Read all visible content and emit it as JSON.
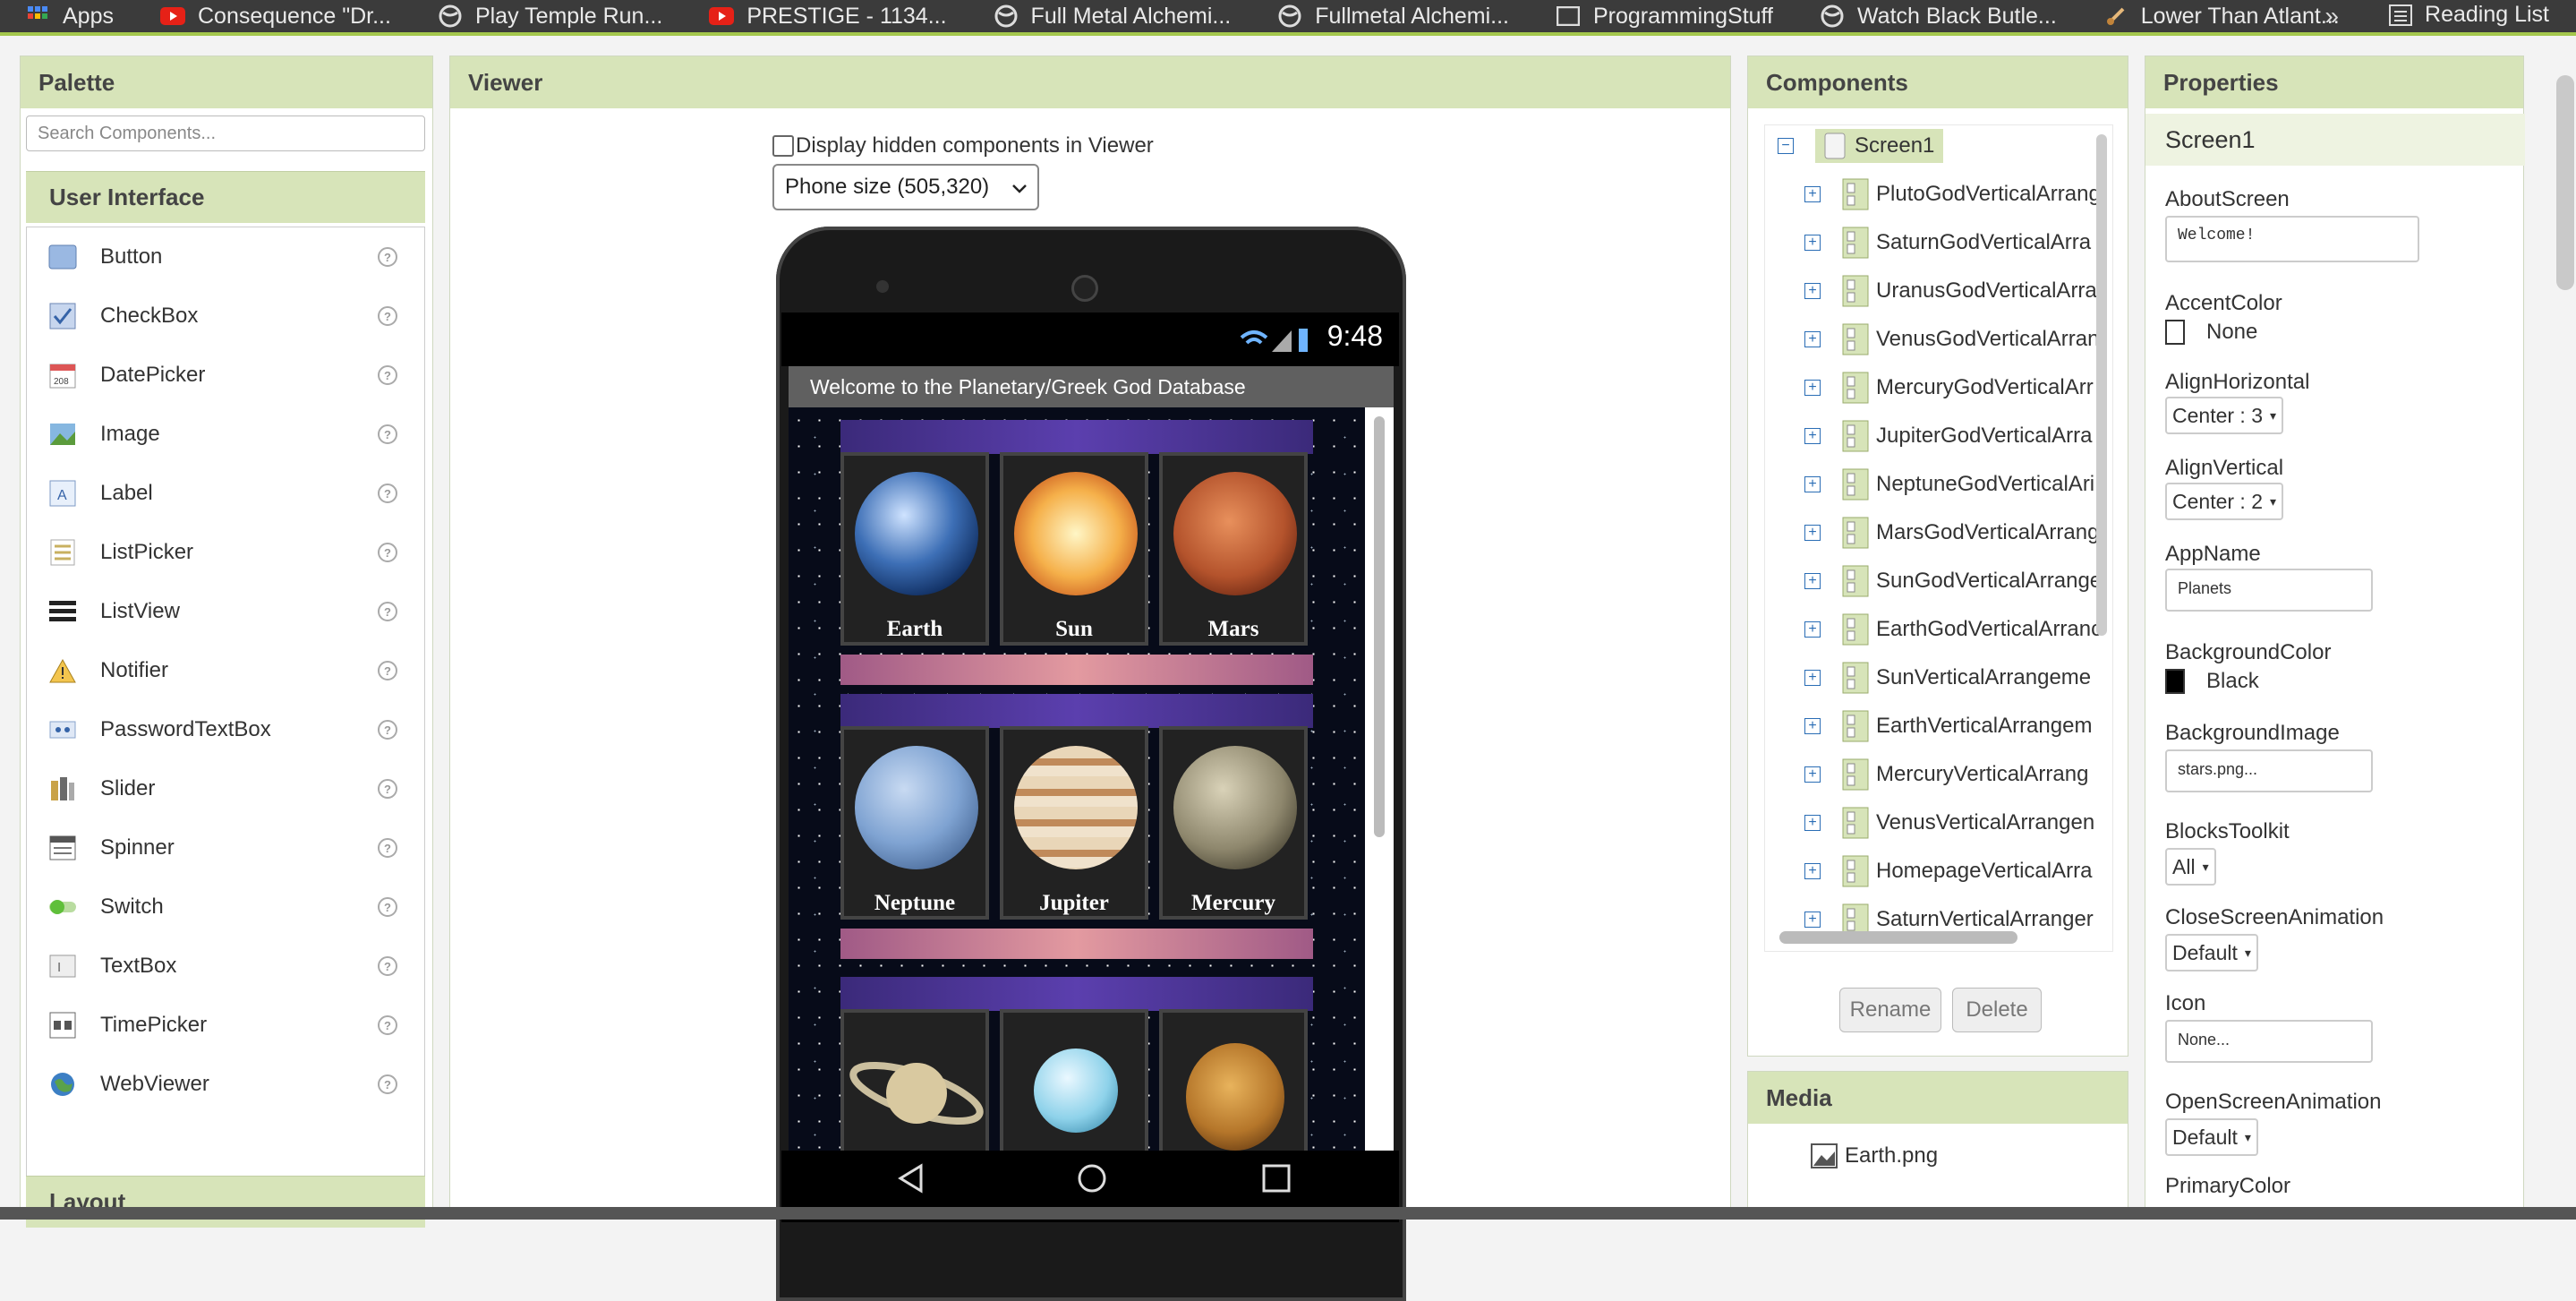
{
  "bookmarks": {
    "items": [
      {
        "label": "Apps",
        "icon": "apps-grid-icon"
      },
      {
        "label": "Consequence \"Dr...",
        "icon": "youtube-icon"
      },
      {
        "label": "Play Temple Run...",
        "icon": "globe-icon"
      },
      {
        "label": "PRESTIGE - 1134...",
        "icon": "youtube-icon"
      },
      {
        "label": "Full Metal Alchemi...",
        "icon": "globe-icon"
      },
      {
        "label": "Fullmetal Alchemi...",
        "icon": "globe-icon"
      },
      {
        "label": "ProgrammingStuff",
        "icon": "folder-icon"
      },
      {
        "label": "Watch Black Butle...",
        "icon": "globe-icon"
      },
      {
        "label": "Lower Than Atlant...",
        "icon": "guitar-icon"
      }
    ],
    "overflow": "»",
    "reading_list": "Reading List"
  },
  "palette": {
    "title": "Palette",
    "search_placeholder": "Search Components...",
    "category": "User Interface",
    "items": [
      {
        "label": "Button",
        "icon": "button-icon"
      },
      {
        "label": "CheckBox",
        "icon": "checkbox-icon"
      },
      {
        "label": "DatePicker",
        "icon": "datepicker-icon"
      },
      {
        "label": "Image",
        "icon": "image-icon"
      },
      {
        "label": "Label",
        "icon": "label-icon"
      },
      {
        "label": "ListPicker",
        "icon": "listpicker-icon"
      },
      {
        "label": "ListView",
        "icon": "listview-icon"
      },
      {
        "label": "Notifier",
        "icon": "notifier-icon"
      },
      {
        "label": "PasswordTextBox",
        "icon": "password-icon"
      },
      {
        "label": "Slider",
        "icon": "slider-icon"
      },
      {
        "label": "Spinner",
        "icon": "spinner-icon"
      },
      {
        "label": "Switch",
        "icon": "switch-icon"
      },
      {
        "label": "TextBox",
        "icon": "textbox-icon"
      },
      {
        "label": "TimePicker",
        "icon": "timepicker-icon"
      },
      {
        "label": "WebViewer",
        "icon": "webviewer-icon"
      }
    ],
    "help": "?",
    "layout_category": "Layout"
  },
  "viewer": {
    "title": "Viewer",
    "hidden_label": "Display hidden components in Viewer",
    "size_selected": "Phone size (505,320)",
    "phone": {
      "time": "9:48",
      "app_title": "Welcome to the Planetary/Greek God Database",
      "rows": [
        [
          {
            "name": "Earth"
          },
          {
            "name": "Sun"
          },
          {
            "name": "Mars"
          }
        ],
        [
          {
            "name": "Neptune"
          },
          {
            "name": "Jupiter"
          },
          {
            "name": "Mercury"
          }
        ],
        [
          {
            "name": ""
          },
          {
            "name": ""
          },
          {
            "name": ""
          }
        ]
      ]
    }
  },
  "components": {
    "title": "Components",
    "root": "Screen1",
    "children": [
      "PlutoGodVerticalArrang",
      "SaturnGodVerticalArra",
      "UranusGodVerticalArra",
      "VenusGodVerticalArran",
      "MercuryGodVerticalArr",
      "JupiterGodVerticalArra",
      "NeptuneGodVerticalAri",
      "MarsGodVerticalArrang",
      "SunGodVerticalArrange",
      "EarthGodVerticalArranc",
      "SunVerticalArrangeme",
      "EarthVerticalArrangem",
      "MercuryVerticalArrang",
      "VenusVerticalArrangen",
      "HomepageVerticalArra",
      "SaturnVerticalArranger"
    ],
    "rename": "Rename",
    "delete": "Delete"
  },
  "media": {
    "title": "Media",
    "items": [
      "Earth.png"
    ]
  },
  "properties": {
    "title": "Properties",
    "screen": "Screen1",
    "about_label": "AboutScreen",
    "about_value": "Welcome!",
    "accent_label": "AccentColor",
    "accent_value": "None",
    "align_h_label": "AlignHorizontal",
    "align_h_value": "Center : 3",
    "align_v_label": "AlignVertical",
    "align_v_value": "Center : 2",
    "appname_label": "AppName",
    "appname_value": "Planets",
    "bgcolor_label": "BackgroundColor",
    "bgcolor_value": "Black",
    "bgimage_label": "BackgroundImage",
    "bgimage_value": "stars.png...",
    "blocks_label": "BlocksToolkit",
    "blocks_value": "All",
    "close_anim_label": "CloseScreenAnimation",
    "close_anim_value": "Default",
    "icon_label": "Icon",
    "icon_value": "None...",
    "open_anim_label": "OpenScreenAnimation",
    "open_anim_value": "Default",
    "primary_label": "PrimaryColor"
  },
  "colors": {
    "accent": "#d7e4b9",
    "bookmark_bg": "#3b3b3b"
  }
}
